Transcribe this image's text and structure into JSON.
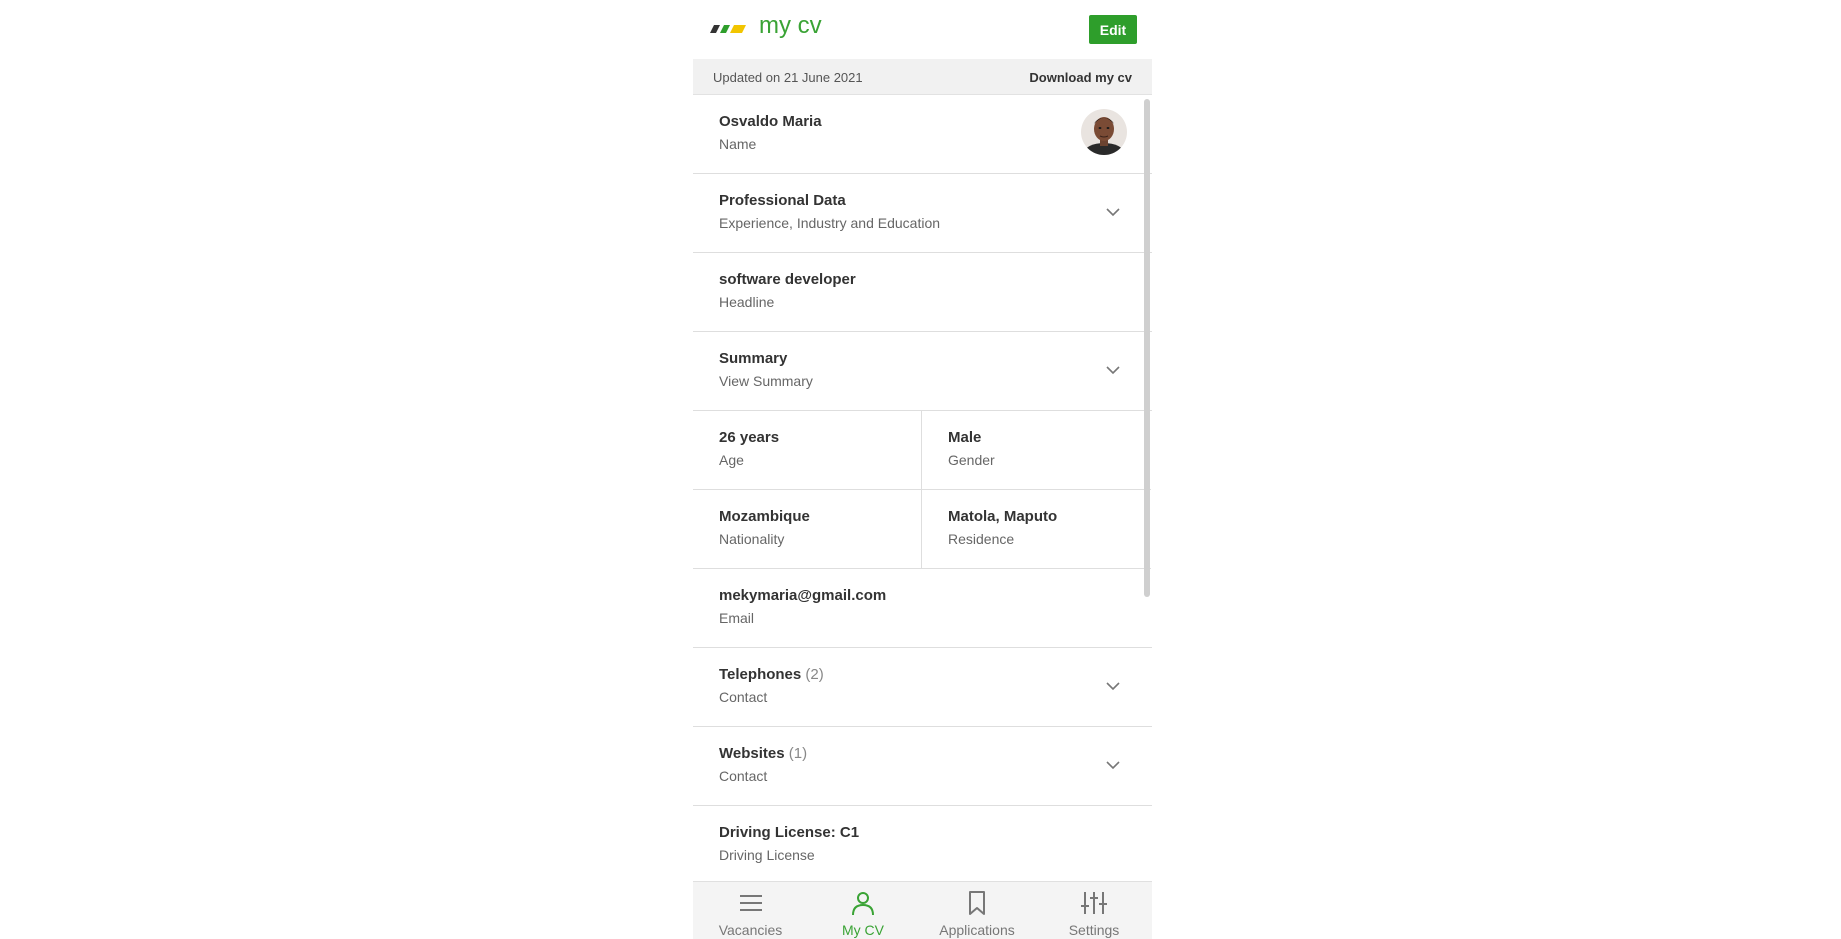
{
  "header": {
    "title": "my cv",
    "edit_label": "Edit"
  },
  "subbar": {
    "updated_text": "Updated on 21 June 2021",
    "download_label": "Download my cv"
  },
  "profile": {
    "name": "Osvaldo Maria",
    "name_label": "Name"
  },
  "rows": {
    "professional": {
      "title": "Professional Data",
      "subtitle": "Experience, Industry and Education"
    },
    "headline": {
      "title": "software developer",
      "subtitle": "Headline"
    },
    "summary": {
      "title": "Summary",
      "subtitle": "View Summary"
    },
    "age": {
      "title": "26 years",
      "subtitle": "Age"
    },
    "gender": {
      "title": "Male",
      "subtitle": "Gender"
    },
    "nationality": {
      "title": "Mozambique",
      "subtitle": "Nationality"
    },
    "residence": {
      "title": "Matola, Maputo",
      "subtitle": "Residence"
    },
    "email": {
      "title": "mekymaria@gmail.com",
      "subtitle": "Email"
    },
    "telephones": {
      "title": "Telephones",
      "count": "(2)",
      "subtitle": "Contact"
    },
    "websites": {
      "title": "Websites",
      "count": "(1)",
      "subtitle": "Contact"
    },
    "license": {
      "title": "Driving License: C1",
      "subtitle": "Driving License"
    }
  },
  "nav": {
    "items": [
      {
        "label": "Vacancies",
        "icon": "menu-icon"
      },
      {
        "label": "My CV",
        "icon": "person-icon"
      },
      {
        "label": "Applications",
        "icon": "bookmark-icon"
      },
      {
        "label": "Settings",
        "icon": "sliders-icon"
      }
    ],
    "active": "My CV"
  },
  "colors": {
    "brand_green": "#3aa335",
    "button_green": "#2e9e2b",
    "logo_yellow": "#f2c500",
    "logo_dark": "#333333"
  }
}
